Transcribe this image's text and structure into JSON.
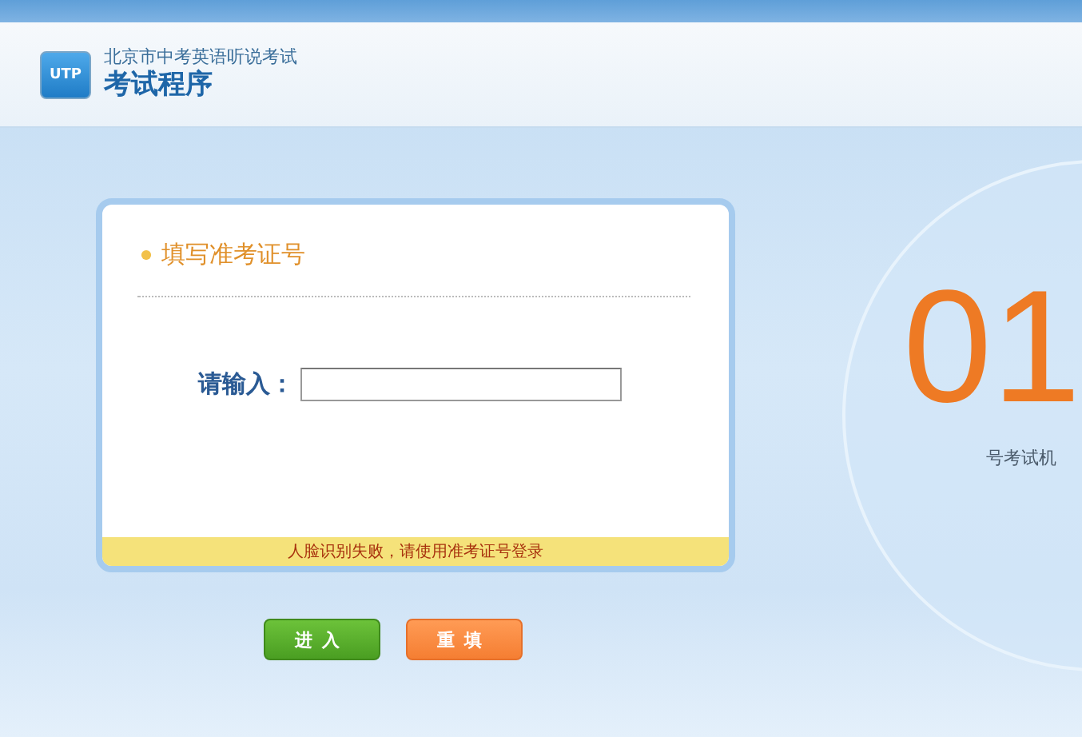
{
  "header": {
    "logo": "UTP",
    "subtitle": "北京市中考英语听说考试",
    "title": "考试程序"
  },
  "form": {
    "title": "填写准考证号",
    "input_label": "请输入：",
    "notice": "人脸识别失败，请使用准考证号登录"
  },
  "buttons": [
    {
      "label": "进入",
      "kind": "primary"
    },
    {
      "label": "重填",
      "kind": "reset"
    }
  ],
  "machine": {
    "number": "01",
    "label": "号考试机"
  }
}
